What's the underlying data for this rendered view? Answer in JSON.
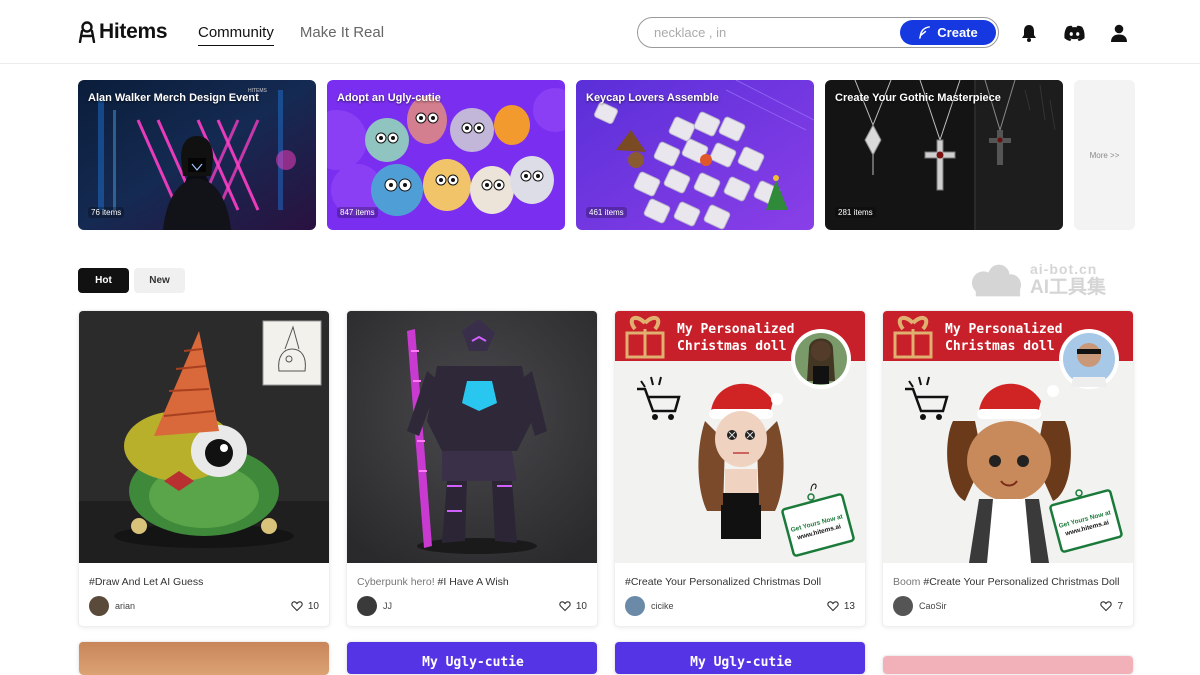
{
  "header": {
    "logo_text": "Hitems",
    "nav": [
      {
        "label": "Community",
        "active": true
      },
      {
        "label": "Make It Real",
        "active": false
      }
    ],
    "search_placeholder": "necklace , in",
    "create_label": "Create"
  },
  "banners": [
    {
      "title": "Alan Walker Merch Design Event",
      "count": "76 items"
    },
    {
      "title": "Adopt an Ugly-cutie",
      "count": "847 items"
    },
    {
      "title": "Keycap Lovers Assemble",
      "count": "461 items"
    },
    {
      "title": "Create Your Gothic Masterpiece",
      "count": "281 items"
    }
  ],
  "more_label": "More >>",
  "tabs": [
    {
      "label": "Hot",
      "active": true
    },
    {
      "label": "New",
      "active": false
    }
  ],
  "watermark": {
    "top": "ai-bot.cn",
    "bottom": "AI工具集"
  },
  "posts": [
    {
      "caption_muted": "",
      "caption": "#Draw And Let AI Guess",
      "user": "arian",
      "likes": "10"
    },
    {
      "caption_muted": "Cyberpunk hero! ",
      "caption": "#I Have A Wish",
      "user": "JJ",
      "likes": "10"
    },
    {
      "caption_muted": "",
      "caption": "#Create Your Personalized Christmas Doll",
      "user": "cicike",
      "likes": "13",
      "header_text_1": "My Personalized",
      "header_text_2": "Christmas doll",
      "tag_text_1": "Get Yours Now at",
      "tag_text_2": "www.hitems.ai"
    },
    {
      "caption_muted": "Boom ",
      "caption": "#Create Your Personalized Christmas Doll",
      "user": "CaoSir",
      "likes": "7",
      "header_text_1": "My Personalized",
      "header_text_2": "Christmas doll",
      "tag_text_1": "Get Yours Now at",
      "tag_text_2": "www.hitems.ai"
    }
  ],
  "next_row": [
    {
      "header": ""
    },
    {
      "header": "My Ugly-cutie"
    },
    {
      "header": "My Ugly-cutie"
    },
    {
      "header": ""
    }
  ],
  "colors": {
    "accent": "#1538e0",
    "xmas_red": "#c8202a",
    "ugly_purple": "#5534e6"
  }
}
